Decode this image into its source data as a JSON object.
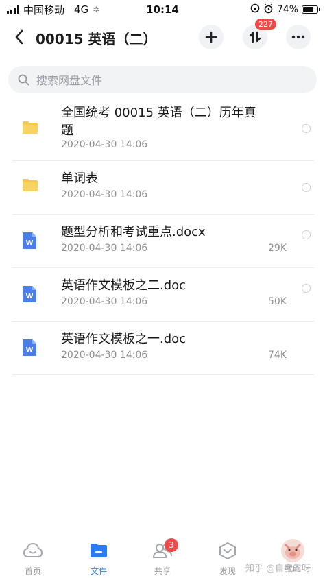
{
  "status_bar": {
    "carrier": "中国移动",
    "network": "4G",
    "time": "10:14",
    "battery_text": "74%",
    "battery_level": 0.74
  },
  "header": {
    "title": "00015 英语（二）",
    "transfer_badge": "227",
    "icons": [
      "back-arrow-icon",
      "plus-icon",
      "transfer-icon",
      "more-icon"
    ]
  },
  "search": {
    "placeholder": "搜索网盘文件"
  },
  "files": [
    {
      "type": "folder",
      "name": "全国统考 00015 英语（二）历年真题",
      "date": "2020-04-30 14:06",
      "size": ""
    },
    {
      "type": "folder",
      "name": "单词表",
      "date": "2020-04-30 14:06",
      "size": ""
    },
    {
      "type": "word",
      "name": "题型分析和考试重点.docx",
      "date": "2020-04-30 14:06",
      "size": "29K"
    },
    {
      "type": "word",
      "name": "英语作文模板之二.doc",
      "date": "2020-04-30 14:06",
      "size": "50K"
    },
    {
      "type": "word",
      "name": "英语作文模板之一.doc",
      "date": "2020-04-30 14:06",
      "size": "74K"
    }
  ],
  "tabs": [
    {
      "label": "首页",
      "icon": "cloud-icon",
      "active": false
    },
    {
      "label": "文件",
      "icon": "folder-icon",
      "active": true
    },
    {
      "label": "共享",
      "icon": "people-icon",
      "active": false,
      "badge": "3"
    },
    {
      "label": "发现",
      "icon": "discover-icon",
      "active": false
    },
    {
      "label": "我的",
      "icon": "avatar-icon",
      "active": false
    }
  ],
  "watermark": "知乎 @自考君呀",
  "colors": {
    "accent": "#2a7cf6",
    "badge": "#ee4a4a",
    "folder": "#f7c948",
    "word": "#4a7ee8"
  }
}
